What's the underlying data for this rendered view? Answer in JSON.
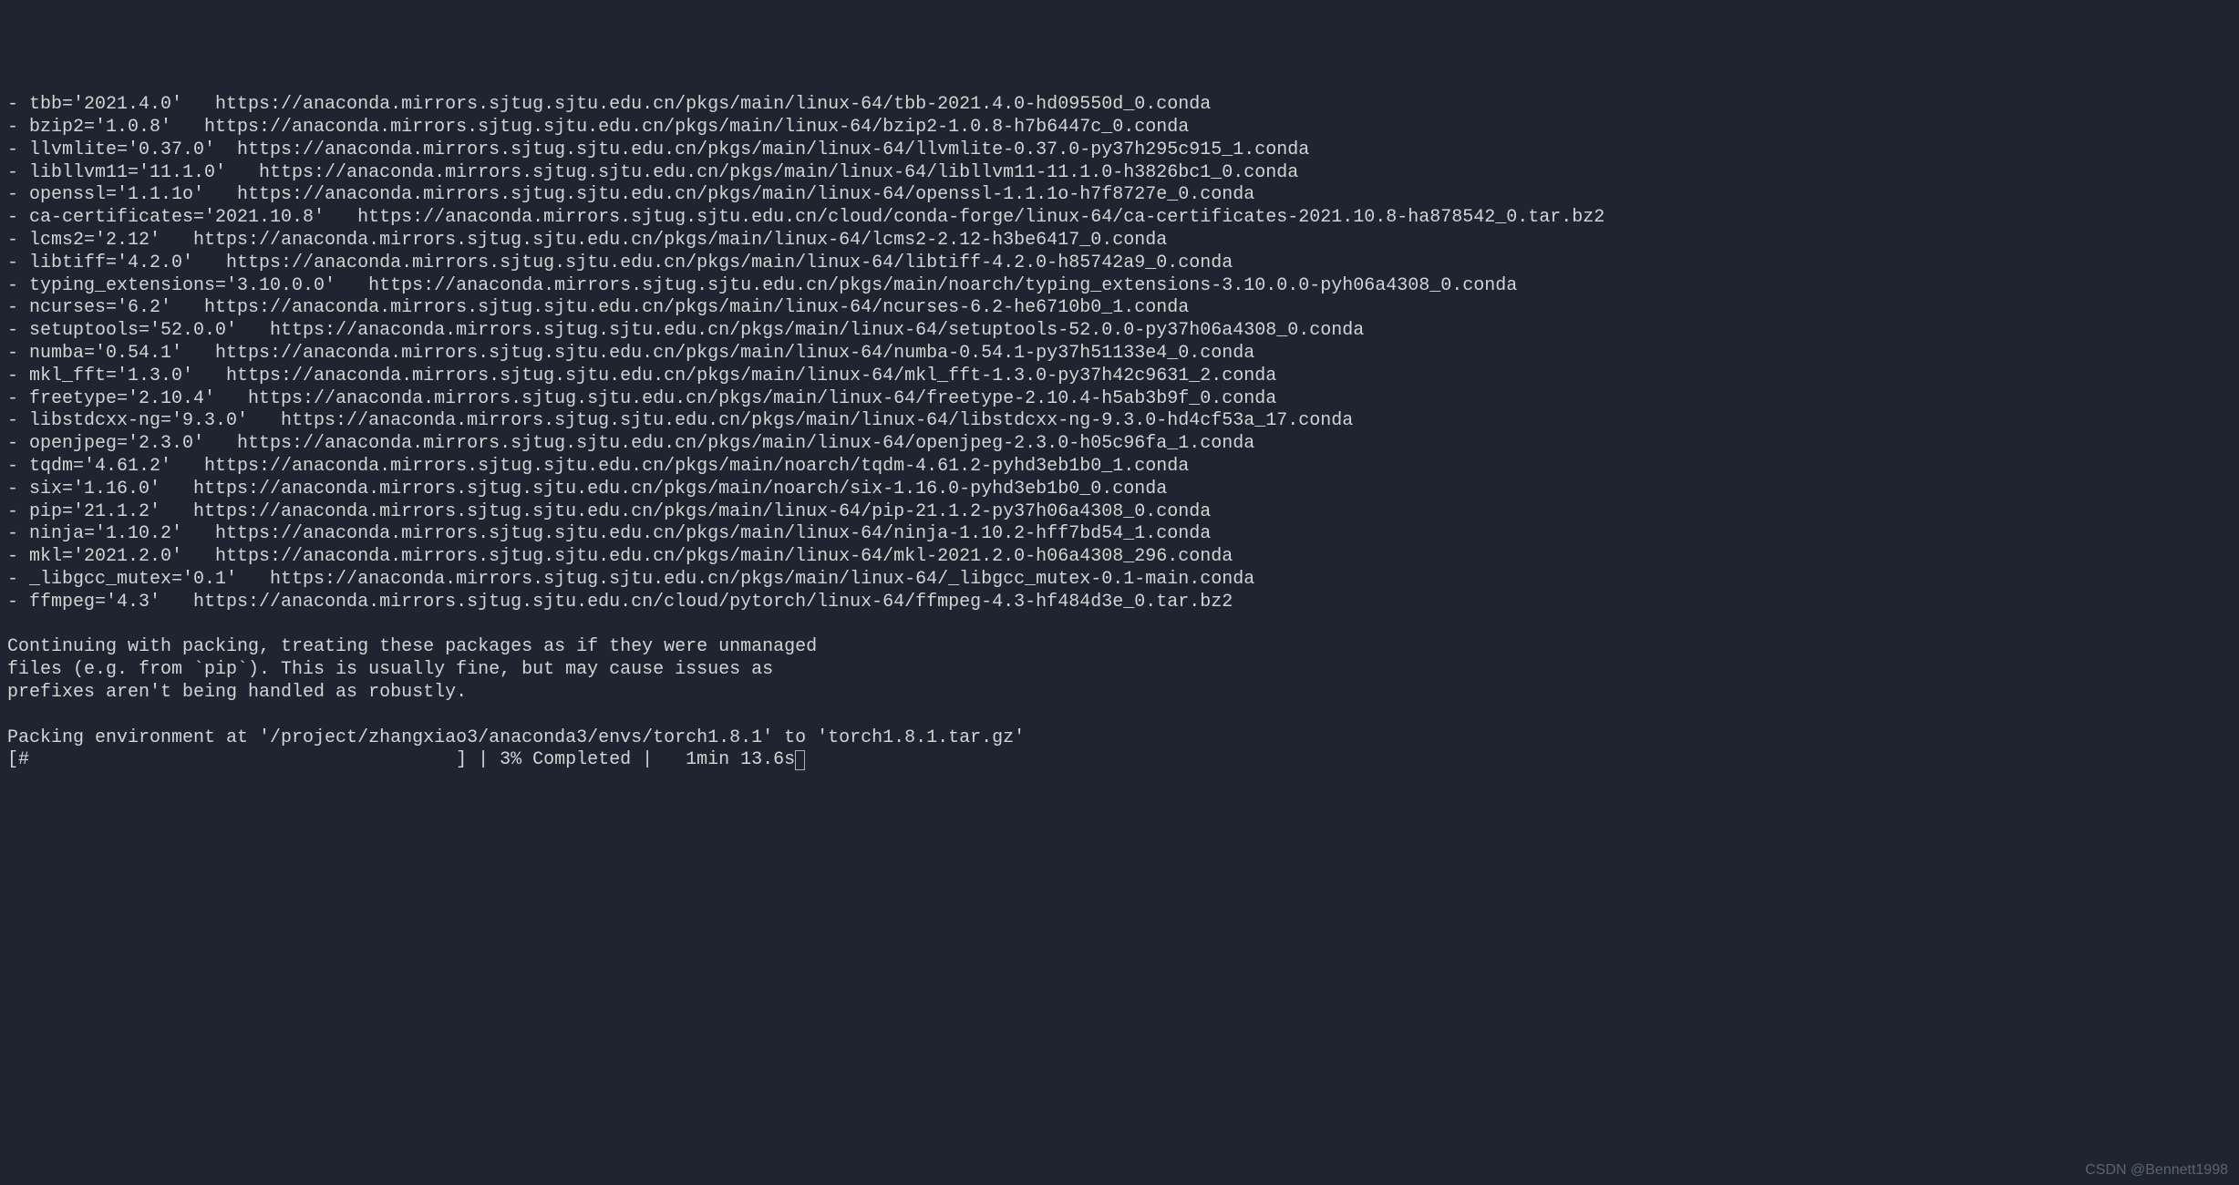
{
  "packages": [
    {
      "name": "tbb",
      "version": "2021.4.0",
      "url": "https://anaconda.mirrors.sjtug.sjtu.edu.cn/pkgs/main/linux-64/tbb-2021.4.0-hd09550d_0.conda",
      "pad": "   "
    },
    {
      "name": "bzip2",
      "version": "1.0.8",
      "url": "https://anaconda.mirrors.sjtug.sjtu.edu.cn/pkgs/main/linux-64/bzip2-1.0.8-h7b6447c_0.conda",
      "pad": "   "
    },
    {
      "name": "llvmlite",
      "version": "0.37.0",
      "url": "https://anaconda.mirrors.sjtug.sjtu.edu.cn/pkgs/main/linux-64/llvmlite-0.37.0-py37h295c915_1.conda",
      "pad": "  "
    },
    {
      "name": "libllvm11",
      "version": "11.1.0",
      "url": "https://anaconda.mirrors.sjtug.sjtu.edu.cn/pkgs/main/linux-64/libllvm11-11.1.0-h3826bc1_0.conda",
      "pad": "   "
    },
    {
      "name": "openssl",
      "version": "1.1.1o",
      "url": "https://anaconda.mirrors.sjtug.sjtu.edu.cn/pkgs/main/linux-64/openssl-1.1.1o-h7f8727e_0.conda",
      "pad": "   "
    },
    {
      "name": "ca-certificates",
      "version": "2021.10.8",
      "url": "https://anaconda.mirrors.sjtug.sjtu.edu.cn/cloud/conda-forge/linux-64/ca-certificates-2021.10.8-ha878542_0.tar.bz2",
      "pad": "   "
    },
    {
      "name": "lcms2",
      "version": "2.12",
      "url": "https://anaconda.mirrors.sjtug.sjtu.edu.cn/pkgs/main/linux-64/lcms2-2.12-h3be6417_0.conda",
      "pad": "   "
    },
    {
      "name": "libtiff",
      "version": "4.2.0",
      "url": "https://anaconda.mirrors.sjtug.sjtu.edu.cn/pkgs/main/linux-64/libtiff-4.2.0-h85742a9_0.conda",
      "pad": "   "
    },
    {
      "name": "typing_extensions",
      "version": "3.10.0.0",
      "url": "https://anaconda.mirrors.sjtug.sjtu.edu.cn/pkgs/main/noarch/typing_extensions-3.10.0.0-pyh06a4308_0.conda",
      "pad": "   "
    },
    {
      "name": "ncurses",
      "version": "6.2",
      "url": "https://anaconda.mirrors.sjtug.sjtu.edu.cn/pkgs/main/linux-64/ncurses-6.2-he6710b0_1.conda",
      "pad": "   "
    },
    {
      "name": "setuptools",
      "version": "52.0.0",
      "url": "https://anaconda.mirrors.sjtug.sjtu.edu.cn/pkgs/main/linux-64/setuptools-52.0.0-py37h06a4308_0.conda",
      "pad": "   "
    },
    {
      "name": "numba",
      "version": "0.54.1",
      "url": "https://anaconda.mirrors.sjtug.sjtu.edu.cn/pkgs/main/linux-64/numba-0.54.1-py37h51133e4_0.conda",
      "pad": "   "
    },
    {
      "name": "mkl_fft",
      "version": "1.3.0",
      "url": "https://anaconda.mirrors.sjtug.sjtu.edu.cn/pkgs/main/linux-64/mkl_fft-1.3.0-py37h42c9631_2.conda",
      "pad": "   "
    },
    {
      "name": "freetype",
      "version": "2.10.4",
      "url": "https://anaconda.mirrors.sjtug.sjtu.edu.cn/pkgs/main/linux-64/freetype-2.10.4-h5ab3b9f_0.conda",
      "pad": "   "
    },
    {
      "name": "libstdcxx-ng",
      "version": "9.3.0",
      "url": "https://anaconda.mirrors.sjtug.sjtu.edu.cn/pkgs/main/linux-64/libstdcxx-ng-9.3.0-hd4cf53a_17.conda",
      "pad": "   "
    },
    {
      "name": "openjpeg",
      "version": "2.3.0",
      "url": "https://anaconda.mirrors.sjtug.sjtu.edu.cn/pkgs/main/linux-64/openjpeg-2.3.0-h05c96fa_1.conda",
      "pad": "   "
    },
    {
      "name": "tqdm",
      "version": "4.61.2",
      "url": "https://anaconda.mirrors.sjtug.sjtu.edu.cn/pkgs/main/noarch/tqdm-4.61.2-pyhd3eb1b0_1.conda",
      "pad": "   "
    },
    {
      "name": "six",
      "version": "1.16.0",
      "url": "https://anaconda.mirrors.sjtug.sjtu.edu.cn/pkgs/main/noarch/six-1.16.0-pyhd3eb1b0_0.conda",
      "pad": "   "
    },
    {
      "name": "pip",
      "version": "21.1.2",
      "url": "https://anaconda.mirrors.sjtug.sjtu.edu.cn/pkgs/main/linux-64/pip-21.1.2-py37h06a4308_0.conda",
      "pad": "   "
    },
    {
      "name": "ninja",
      "version": "1.10.2",
      "url": "https://anaconda.mirrors.sjtug.sjtu.edu.cn/pkgs/main/linux-64/ninja-1.10.2-hff7bd54_1.conda",
      "pad": "   "
    },
    {
      "name": "mkl",
      "version": "2021.2.0",
      "url": "https://anaconda.mirrors.sjtug.sjtu.edu.cn/pkgs/main/linux-64/mkl-2021.2.0-h06a4308_296.conda",
      "pad": "   "
    },
    {
      "name": "_libgcc_mutex",
      "version": "0.1",
      "url": "https://anaconda.mirrors.sjtug.sjtu.edu.cn/pkgs/main/linux-64/_libgcc_mutex-0.1-main.conda",
      "pad": "   "
    },
    {
      "name": "ffmpeg",
      "version": "4.3",
      "url": "https://anaconda.mirrors.sjtug.sjtu.edu.cn/cloud/pytorch/linux-64/ffmpeg-4.3-hf484d3e_0.tar.bz2",
      "pad": "   "
    }
  ],
  "messages": {
    "continuing_1": "Continuing with packing, treating these packages as if they were unmanaged",
    "continuing_2": "files (e.g. from `pip`). This is usually fine, but may cause issues as",
    "continuing_3": "prefixes aren't being handled as robustly.",
    "packing": "Packing environment at '/project/zhangxiao3/anaconda3/envs/torch1.8.1' to 'torch1.8.1.tar.gz'"
  },
  "progress": {
    "bar_open": "[",
    "bar_fill": "#",
    "bar_empty": "                                       ",
    "bar_close": "]",
    "separator": " | ",
    "percent": "3% Completed",
    "time": "1min 13.6s"
  },
  "watermark": "CSDN @Bennett1998"
}
